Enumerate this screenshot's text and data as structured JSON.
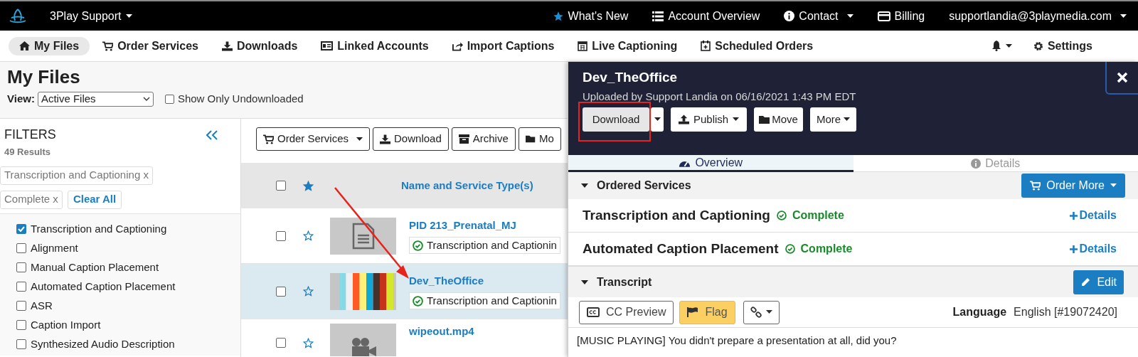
{
  "top_bar": {
    "brand": "3Play Support",
    "items": [
      {
        "label": "What's New",
        "dropdown": false
      },
      {
        "label": "Account Overview",
        "dropdown": false
      },
      {
        "label": "Contact",
        "dropdown": true
      },
      {
        "label": "Billing",
        "dropdown": false
      },
      {
        "label": "supportlandia@3playmedia.com",
        "dropdown": true
      }
    ]
  },
  "nav": {
    "items": [
      {
        "label": "My Files",
        "selected": true
      },
      {
        "label": "Order Services",
        "selected": false
      },
      {
        "label": "Downloads",
        "selected": false
      },
      {
        "label": "Linked Accounts",
        "selected": false
      },
      {
        "label": "Import Captions",
        "selected": false
      },
      {
        "label": "Live Captioning",
        "selected": false
      },
      {
        "label": "Scheduled Orders",
        "selected": false
      }
    ],
    "settings": "Settings"
  },
  "page": {
    "title": "My Files",
    "view_label": "View:",
    "view_value": "Active Files",
    "undownloaded": {
      "label": "Show Only Undownloaded",
      "checked": false
    }
  },
  "filters": {
    "title": "FILTERS",
    "count": "49 Results",
    "chips": [
      "Transcription and Captioning x",
      "Complete x"
    ],
    "clear": "Clear All",
    "options": [
      {
        "label": "Transcription and Captioning",
        "checked": true
      },
      {
        "label": "Alignment",
        "checked": false
      },
      {
        "label": "Manual Caption Placement",
        "checked": false
      },
      {
        "label": "Automated Caption Placement",
        "checked": false
      },
      {
        "label": "ASR",
        "checked": false
      },
      {
        "label": "Caption Import",
        "checked": false
      },
      {
        "label": "Synthesized Audio Description",
        "checked": false
      }
    ]
  },
  "toolbar": [
    "Order Services",
    "Download",
    "Archive",
    "Mo"
  ],
  "table": {
    "header": "Name and Service Type(s)",
    "header_starred": true,
    "header_checked": false,
    "rows": [
      {
        "name": "PID 213_Prenatal_MJ",
        "service": "Transcription and Captionin",
        "kind": "document",
        "selected": false,
        "starred": false,
        "checked": false
      },
      {
        "name": "Dev_TheOffice",
        "service": "Transcription and Captionin",
        "kind": "color_bars",
        "selected": true,
        "starred": false,
        "checked": false
      },
      {
        "name": "wipeout.mp4",
        "kind": "video",
        "selected": false,
        "starred": false,
        "checked": false
      }
    ]
  },
  "panel": {
    "title": "Dev_TheOffice",
    "subtitle": "Uploaded by Support Landia on 06/16/2021 1:43 PM EDT",
    "buttons": [
      "Download",
      "Publish",
      "Move",
      "More"
    ],
    "tabs": [
      {
        "label": "Overview",
        "selected": true
      },
      {
        "label": "Details",
        "selected": false
      }
    ],
    "ordered_services": {
      "title": "Ordered Services",
      "button": "Order More",
      "services": [
        {
          "name": "Transcription and Captioning",
          "status": "Complete",
          "link": "Details"
        },
        {
          "name": "Automated Caption Placement",
          "status": "Complete",
          "link": "Details"
        }
      ]
    },
    "transcript": {
      "title": "Transcript",
      "button": "Edit",
      "cc_preview": "CC Preview",
      "flag": {
        "label": "Flag",
        "on": true
      },
      "language_label": "Language",
      "language": "English [#19072420]",
      "text": "[MUSIC PLAYING] You didn't prepare a presentation at all, did you?"
    }
  }
}
